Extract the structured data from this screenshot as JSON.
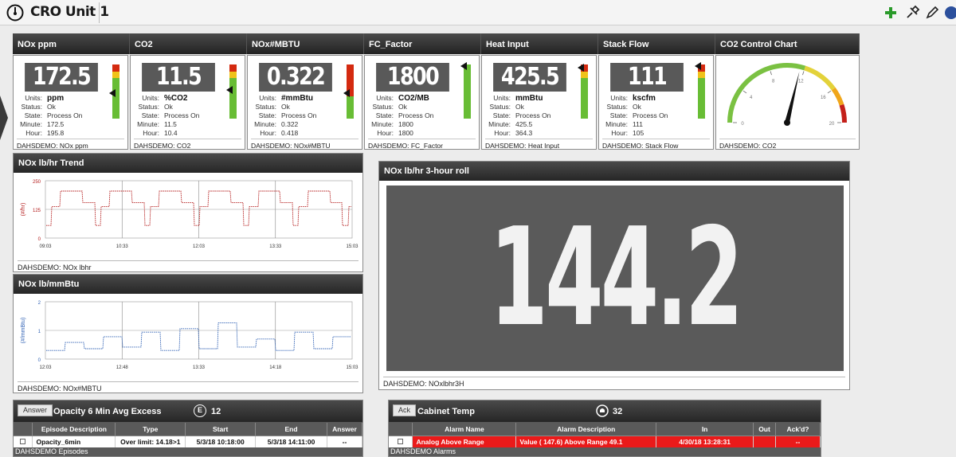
{
  "app": {
    "title": "CRO Unit 1",
    "toolbar_icons": [
      "plus-icon",
      "pin-icon",
      "edit-icon",
      "help-icon"
    ],
    "accent": "#2a9a2a"
  },
  "tiles": [
    {
      "name": "NOx ppm",
      "value": "172.5",
      "units": "ppm",
      "status": "Ok",
      "state": "Process On",
      "minute": "172.5",
      "hour": "195.8",
      "source": "DAHSDEMO: NOx ppm",
      "bar": "full"
    },
    {
      "name": "CO2",
      "value": "11.5",
      "units": "%CO2",
      "status": "Ok",
      "state": "Process On",
      "minute": "11.5",
      "hour": "10.4",
      "source": "DAHSDEMO: CO2",
      "bar": "full"
    },
    {
      "name": "NOx#MBTU",
      "value": "0.322",
      "units": "#mmBtu",
      "status": "Ok",
      "state": "Process On",
      "minute": "0.322",
      "hour": "0.418",
      "source": "DAHSDEMO: NOx#MBTU",
      "bar": "red"
    },
    {
      "name": "FC_Factor",
      "value": "1800",
      "units": "CO2/MB",
      "status": "Ok",
      "state": "Process On",
      "minute": "1800",
      "hour": "1800",
      "source": "DAHSDEMO: FC_Factor",
      "bar": "green"
    },
    {
      "name": "Heat Input",
      "value": "425.5",
      "units": "mmBtu",
      "status": "Ok",
      "state": "Process On",
      "minute": "425.5",
      "hour": "364.3",
      "source": "DAHSDEMO: Heat Input",
      "bar": "full"
    },
    {
      "name": "Stack Flow",
      "value": "111",
      "units": "kscfm",
      "status": "Ok",
      "state": "Process On",
      "minute": "111",
      "hour": "105",
      "source": "DAHSDEMO: Stack Flow",
      "bar": "full"
    }
  ],
  "labels": {
    "units": "Units:",
    "status": "Status:",
    "state": "State:",
    "minute": "Minute:",
    "hour": "Hour:"
  },
  "gauge": {
    "title": "CO2 Control Chart",
    "ticks": [
      "0",
      "4",
      "8",
      "12",
      "16",
      "20"
    ],
    "value": 11.5,
    "max": 20,
    "source": "DAHSDEMO: CO2"
  },
  "trend1": {
    "title": "NOx lb/hr Trend",
    "ylabel": "(#/hr)",
    "yticks": [
      "250",
      "125",
      "0"
    ],
    "xticks": [
      "09:03",
      "10:33",
      "12:03",
      "13:33",
      "15:03"
    ],
    "source": "DAHSDEMO: NOx lbhr"
  },
  "trend2": {
    "title": "NOx lb/mmBtu",
    "ylabel": "(#/mmBtu)",
    "yticks": [
      "2",
      "1",
      "0"
    ],
    "xticks": [
      "12:03",
      "12:48",
      "13:33",
      "14:18",
      "15:03"
    ],
    "source": "DAHSDEMO: NOx#MBTU"
  },
  "roll": {
    "title": "NOx lb/hr 3-hour roll",
    "value": "144.2",
    "source": "DAHSDEMO: NOxlbhr3H"
  },
  "episodes": {
    "button": "Answer",
    "title": "Opacity 6 Min Avg Excess",
    "icon_letter": "E",
    "count": "12",
    "columns": [
      "",
      "Episode Description",
      "Type",
      "Start",
      "End",
      "Answer"
    ],
    "rows": [
      [
        "",
        "Opacity_6min",
        "Over limit: 14.18>1",
        "5/3/18 10:18:00",
        "5/3/18 14:11:00",
        "--"
      ]
    ],
    "footer": "DAHSDEMO Episodes"
  },
  "alarms": {
    "button": "Ack",
    "title": "Cabinet Temp",
    "count": "32",
    "alarm_color": "#ea1a1a",
    "columns": [
      "",
      "Alarm Name",
      "Alarm Description",
      "In",
      "Out",
      "Ack'd?"
    ],
    "rows": [
      [
        "",
        "Analog Above Range",
        "Value ( 147.6) Above Range 49.1",
        "4/30/18 13:28:31",
        "",
        "--"
      ]
    ],
    "footer": "DAHSDEMO Alarms"
  }
}
